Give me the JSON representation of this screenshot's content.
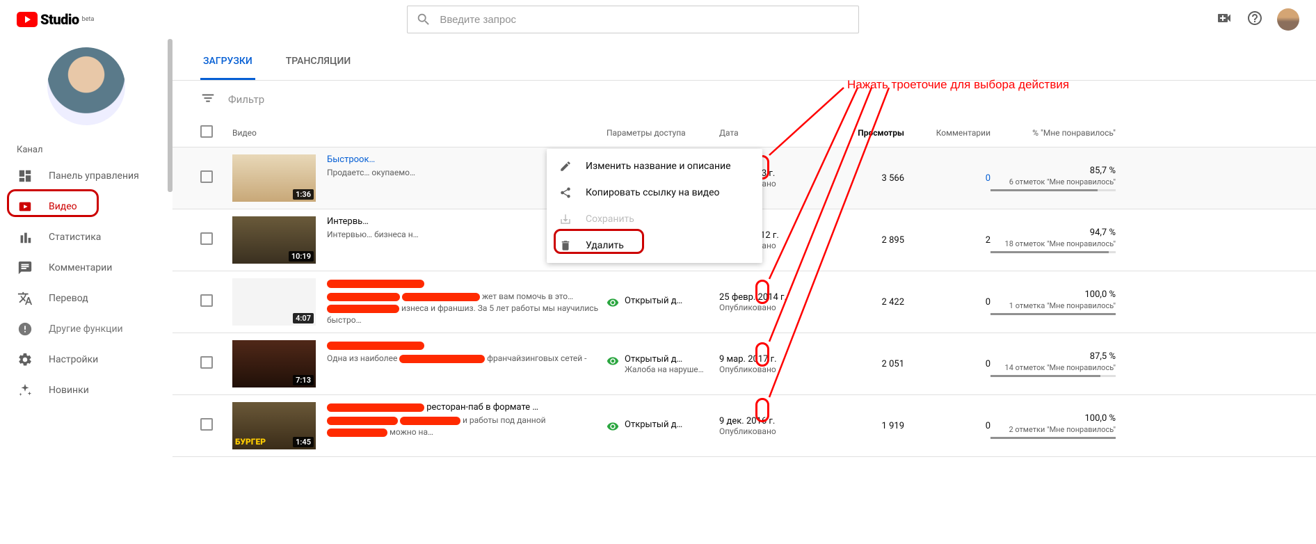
{
  "header": {
    "logo_text": "Studio",
    "logo_sup": "beta",
    "search_placeholder": "Введите запрос"
  },
  "sidebar": {
    "channel_label": "Канал",
    "items": [
      {
        "label": "Панель управления",
        "icon": "dashboard"
      },
      {
        "label": "Видео",
        "icon": "video",
        "active": true
      },
      {
        "label": "Статистика",
        "icon": "bar-chart"
      },
      {
        "label": "Комментарии",
        "icon": "comments"
      },
      {
        "label": "Перевод",
        "icon": "translate"
      },
      {
        "label": "Другие функции",
        "icon": "more"
      },
      {
        "label": "Настройки",
        "icon": "gear"
      },
      {
        "label": "Новинки",
        "icon": "new"
      }
    ]
  },
  "tabs": {
    "uploads": "ЗАГРУЗКИ",
    "live": "ТРАНСЛЯЦИИ"
  },
  "filter": {
    "placeholder": "Фильтр"
  },
  "columns": {
    "video": "Видео",
    "visibility": "Параметры доступа",
    "date": "Дата",
    "views": "Просмотры",
    "comments": "Комментарии",
    "likes": "% \"Мне понравилось\""
  },
  "context_menu": {
    "edit": "Изменить название и описание",
    "copy": "Копировать ссылку на видео",
    "save": "Сохранить",
    "delete": "Удалить"
  },
  "visibility_label": "Открытый д…",
  "published_label": "Опубликовано",
  "complaint_label": "Жалоба на наруше…",
  "rows": [
    {
      "title": "Быстроок…",
      "title_link": true,
      "desc": "Продаетс… окупаемо…",
      "duration": "1:36",
      "thumb_bg": "linear-gradient(#e8d8b8,#c8a878)",
      "complaint": true,
      "edit_icon": true,
      "date": "3 дек. 2013 г.",
      "views": "3 566",
      "comments": "0",
      "comments_link": true,
      "like_pct": "85,7 %",
      "like_sub": "6 отметок \"Мне понравилось\"",
      "like_fill": 85.7,
      "hover": true
    },
    {
      "title": "Интервь…",
      "desc": "Интервью… бизнеса н…",
      "duration": "10:19",
      "thumb_bg": "linear-gradient(#6a5a3a,#3a3020)",
      "date": "29 авг. 2012 г.",
      "views": "2 895",
      "comments": "2",
      "like_pct": "94,7 %",
      "like_sub": "18 отметок \"Мне понравилось\"",
      "like_fill": 94.7
    },
    {
      "title_redacted": true,
      "desc_parts": [
        "",
        "жет вам помочь в это…",
        "изнеса и франшиз. За 5 лет работы мы научились быстро…"
      ],
      "duration": "4:07",
      "thumb_bg": "#f4f4f4",
      "thumb_overlay": "factor",
      "date": "25 февр. 2014 г.",
      "views": "2 422",
      "comments": "0",
      "like_pct": "100,0 %",
      "like_sub": "1 отметка \"Мне понравилось\"",
      "like_fill": 100
    },
    {
      "title_redacted": true,
      "desc_parts": [
        "Одна из наиболее ",
        " франчайзинговых сетей - "
      ],
      "duration": "7:13",
      "thumb_bg": "linear-gradient(#502818,#201008)",
      "complaint": true,
      "date": "9 мар. 2017 г.",
      "views": "2 051",
      "comments": "0",
      "like_pct": "87,5 %",
      "like_sub": "14 отметок \"Мне понравилось\"",
      "like_fill": 87.5
    },
    {
      "title_redacted": true,
      "title_suffix": " ресторан-паб в формате …",
      "desc_parts": [
        "",
        "и работы под данной ",
        "можно на…"
      ],
      "duration": "1:45",
      "thumb_bg": "linear-gradient(#6a5838,#3a2c18)",
      "thumb_text": "БУРГЕР",
      "date": "9 дек. 2016 г.",
      "views": "1 919",
      "comments": "0",
      "like_pct": "100,0 %",
      "like_sub": "2 отметки \"Мне понравилось\"",
      "like_fill": 100
    }
  ],
  "annotation": {
    "text": "Нажать троеточие для выбора действия"
  }
}
